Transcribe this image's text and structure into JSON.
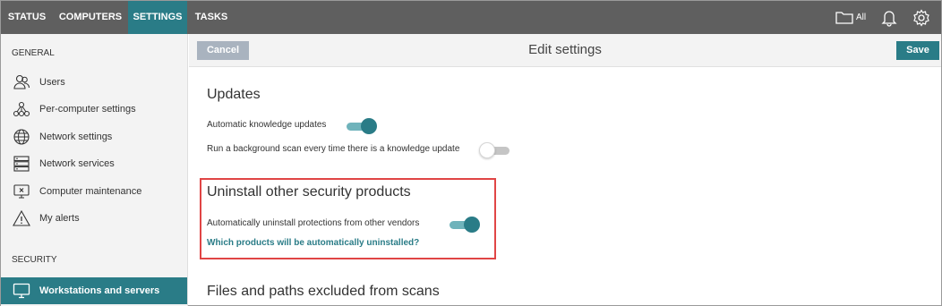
{
  "nav": {
    "items": [
      {
        "label": "STATUS",
        "active": false
      },
      {
        "label": "COMPUTERS",
        "active": false
      },
      {
        "label": "SETTINGS",
        "active": true
      },
      {
        "label": "TASKS",
        "active": false
      }
    ],
    "filter_label": "All",
    "icons": [
      "folder-icon",
      "bell-icon",
      "gear-icon"
    ]
  },
  "sidebar": {
    "general_heading": "GENERAL",
    "general_items": [
      {
        "label": "Users",
        "icon": "users-icon"
      },
      {
        "label": "Per-computer settings",
        "icon": "network-nodes-icon"
      },
      {
        "label": "Network settings",
        "icon": "globe-icon"
      },
      {
        "label": "Network services",
        "icon": "server-icon"
      },
      {
        "label": "Computer maintenance",
        "icon": "monitor-x-icon"
      },
      {
        "label": "My alerts",
        "icon": "warning-icon"
      }
    ],
    "security_heading": "SECURITY",
    "security_items": [
      {
        "label": "Workstations and servers",
        "icon": "monitor-icon",
        "active": true
      }
    ]
  },
  "header": {
    "cancel_label": "Cancel",
    "title": "Edit settings",
    "save_label": "Save"
  },
  "content": {
    "updates": {
      "title": "Updates",
      "auto_knowledge_label": "Automatic knowledge updates",
      "auto_knowledge_on": true,
      "background_scan_label": "Run a background scan every time there is a knowledge update",
      "background_scan_on": false
    },
    "uninstall": {
      "title": "Uninstall other security products",
      "auto_uninstall_label": "Automatically uninstall protections from other vendors",
      "auto_uninstall_on": true,
      "link_label": "Which products will be automatically uninstalled?"
    },
    "excluded": {
      "title": "Files and paths excluded from scans"
    }
  },
  "colors": {
    "accent": "#2a7c87",
    "topbar": "#5f5f5f",
    "highlight": "#e04545",
    "cancel": "#a9b3bf"
  }
}
